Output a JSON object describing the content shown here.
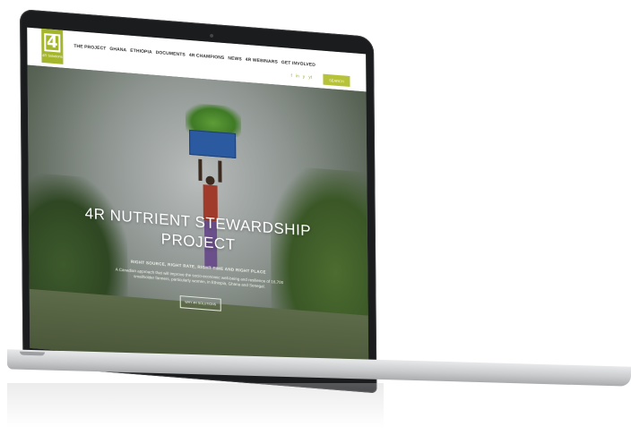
{
  "header": {
    "logo_mark": "4",
    "logo_text": "4R Solutions",
    "nav": [
      "THE PROJECT",
      "GHANA",
      "ETHIOPIA",
      "DOCUMENTS",
      "4R CHAMPIONS",
      "NEWS",
      "4R WEBINARS",
      "GET INVOLVED"
    ],
    "socials": [
      "f",
      "in",
      "y",
      "yt"
    ],
    "search_label": "SEARCH"
  },
  "hero": {
    "title_line1": "4R NUTRIENT STEWARDSHIP",
    "title_line2": "PROJECT",
    "subtitle": "RIGHT SOURCE, RIGHT RATE, RIGHT TIME AND RIGHT PLACE",
    "description": "A Canadian approach that will improve the socio-economic well-being and resilience of 16,700 smallholder farmers, particularly women, in Ethiopia, Ghana and Senegal.",
    "cta_label": "WHY 4R SOLUTIONS"
  },
  "colors": {
    "accent": "#a6b62b",
    "laptop_bezel": "#1b1c1e"
  }
}
